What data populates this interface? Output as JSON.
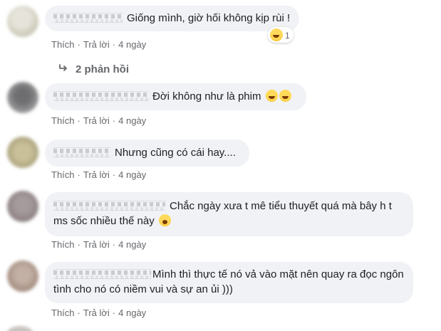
{
  "comments": [
    {
      "text": "Giống mình, giờ hối không kịp rùi !",
      "actions": {
        "like": "Thích",
        "reply": "Trả lời",
        "time": "4 ngày"
      },
      "reaction_count": "1",
      "replies_label": "2 phản hồi",
      "avatar_color": "#d8d7cc",
      "emoji": "laughing-squint-emoji"
    },
    {
      "text": "Đời không như là phim",
      "actions": {
        "like": "Thích",
        "reply": "Trả lời",
        "time": "4 ngày"
      },
      "avatar_color": "#8e8e90",
      "emoji": "rofl-emoji"
    },
    {
      "text": "Nhưng cũng có cái hay....",
      "actions": {
        "like": "Thích",
        "reply": "Trả lời",
        "time": "4 ngày"
      },
      "avatar_color": "#b5ab87"
    },
    {
      "text": "Chắc ngày xưa t mê tiểu thuyết quá mà bây h t ms sốc nhiều thế này",
      "actions": {
        "like": "Thích",
        "reply": "Trả lời",
        "time": "4 ngày"
      },
      "avatar_color": "#9b8f91",
      "emoji": "crying-emoji"
    },
    {
      "text": "Mình thì thực tế nó vả vào mặt nên quay ra đọc ngôn tình cho nó có niềm vui và sự an ủi )))",
      "actions": {
        "like": "Thích",
        "reply": "Trả lời",
        "time": "4 ngày"
      },
      "avatar_color": "#b39e92"
    }
  ],
  "colors": {
    "bubble_bg": "#f0f2f5",
    "meta_text": "#65676b",
    "body_text": "#1c1e21"
  }
}
